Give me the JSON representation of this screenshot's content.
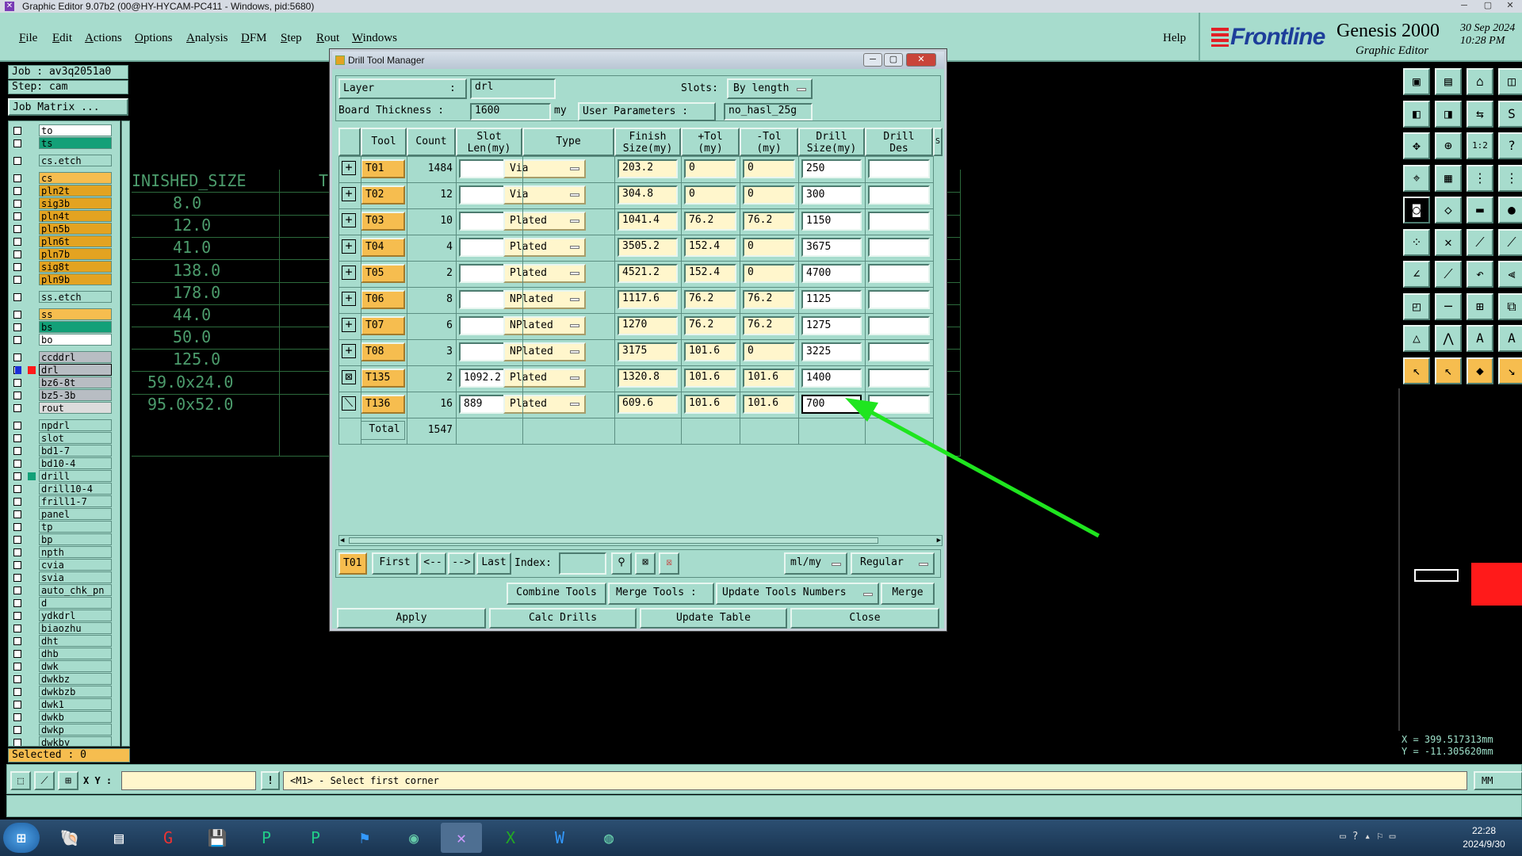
{
  "window": {
    "title": "Graphic Editor 9.07b2 (00@HY-HYCAM-PC411 - Windows, pid:5680)"
  },
  "menu": {
    "items": [
      "File",
      "Edit",
      "Actions",
      "Options",
      "Analysis",
      "DFM",
      "Step",
      "Rout",
      "Windows"
    ],
    "help": "Help"
  },
  "brand": {
    "logo": "Frontline",
    "product": "Genesis 2000",
    "subtitle": "Graphic Editor",
    "date": "30 Sep 2024",
    "time": "10:28 PM"
  },
  "job": {
    "job_label": "Job  : av3q2051a0",
    "step_label": "Step: cam",
    "matrix_button": "Job Matrix ..."
  },
  "layers": [
    {
      "name": "to",
      "color": "#ffffff"
    },
    {
      "name": "ts",
      "color": "#13a078"
    },
    {
      "name": "cs.etch",
      "color": "#a7dccd"
    },
    {
      "name": "cs",
      "color": "#f6bd4f"
    },
    {
      "name": "pln2t",
      "color": "#e3a321"
    },
    {
      "name": "sig3b",
      "color": "#e3a321"
    },
    {
      "name": "pln4t",
      "color": "#e3a321"
    },
    {
      "name": "pln5b",
      "color": "#e3a321"
    },
    {
      "name": "pln6t",
      "color": "#e3a321"
    },
    {
      "name": "pln7b",
      "color": "#e3a321"
    },
    {
      "name": "sig8t",
      "color": "#e3a321"
    },
    {
      "name": "pln9b",
      "color": "#e3a321"
    },
    {
      "name": "ss.etch",
      "color": "#a7dccd"
    },
    {
      "name": "ss",
      "color": "#f6bd4f"
    },
    {
      "name": "bs",
      "color": "#13a078"
    },
    {
      "name": "bo",
      "color": "#ffffff"
    },
    {
      "name": "ccddrl",
      "color": "#b8bdc3"
    },
    {
      "name": "drl",
      "color": "#b8bdc3"
    },
    {
      "name": "bz6-8t",
      "color": "#b8bdc3"
    },
    {
      "name": "bz5-3b",
      "color": "#b8bdc3"
    },
    {
      "name": "rout",
      "color": "#dcdcdc"
    },
    {
      "name": "npdrl",
      "color": "#a7dccd"
    },
    {
      "name": "slot",
      "color": "#a7dccd"
    },
    {
      "name": "bd1-7",
      "color": "#a7dccd"
    },
    {
      "name": "bd10-4",
      "color": "#a7dccd"
    },
    {
      "name": "drill",
      "color": "#a7dccd"
    },
    {
      "name": "drill10-4",
      "color": "#a7dccd"
    },
    {
      "name": "frill1-7",
      "color": "#a7dccd"
    },
    {
      "name": "panel",
      "color": "#a7dccd"
    },
    {
      "name": "tp",
      "color": "#a7dccd"
    },
    {
      "name": "bp",
      "color": "#a7dccd"
    },
    {
      "name": "npth",
      "color": "#a7dccd"
    },
    {
      "name": "cvia",
      "color": "#a7dccd"
    },
    {
      "name": "svia",
      "color": "#a7dccd"
    },
    {
      "name": "auto_chk_pn",
      "color": "#a7dccd"
    },
    {
      "name": "d",
      "color": "#a7dccd"
    },
    {
      "name": "ydkdrl",
      "color": "#a7dccd"
    },
    {
      "name": "biaozhu",
      "color": "#a7dccd"
    },
    {
      "name": "dht",
      "color": "#a7dccd"
    },
    {
      "name": "dhb",
      "color": "#a7dccd"
    },
    {
      "name": "dwk",
      "color": "#a7dccd"
    },
    {
      "name": "dwkbz",
      "color": "#a7dccd"
    },
    {
      "name": "dwkbzb",
      "color": "#a7dccd"
    },
    {
      "name": "dwk1",
      "color": "#a7dccd"
    },
    {
      "name": "dwkb",
      "color": "#a7dccd"
    },
    {
      "name": "dwkp",
      "color": "#a7dccd"
    },
    {
      "name": "dwkby",
      "color": "#a7dccd"
    }
  ],
  "selected_label": "Selected : 0",
  "canvas": {
    "header_partial": "INISHED_SIZE",
    "header_partial_2": "T",
    "values": [
      "8.0",
      "12.0",
      "41.0",
      "138.0",
      "178.0",
      "44.0",
      "50.0",
      "125.0",
      "59.0x24.0",
      "95.0x52.0"
    ]
  },
  "dialog": {
    "title": "Drill Tool Manager",
    "layer_label": "Layer",
    "layer_colon": ":",
    "layer_value": "drl",
    "slots_label": "Slots:",
    "slots_value": "By length",
    "thickness_label": "Board Thickness :",
    "thickness_value": "1600",
    "thickness_unit": "my",
    "user_params_label": "User Parameters :",
    "user_params_value": "no_hasl_25g",
    "columns": {
      "tool": "Tool",
      "count": "Count",
      "slot_len": "Slot\nLen(my)",
      "type": "Type",
      "finish": "Finish\nSize(my)",
      "ptol": "+Tol\n(my)",
      "ntol": "-Tol\n(my)",
      "drill": "Drill\nSize(my)",
      "drill_des": "Drill\nDes",
      "extra": "S"
    },
    "rows": [
      {
        "tool": "T01",
        "count": "1484",
        "slot": "",
        "type": "Via",
        "finish": "203.2",
        "ptol": "0",
        "ntol": "0",
        "drill": "250",
        "des": ""
      },
      {
        "tool": "T02",
        "count": "12",
        "slot": "",
        "type": "Via",
        "finish": "304.8",
        "ptol": "0",
        "ntol": "0",
        "drill": "300",
        "des": ""
      },
      {
        "tool": "T03",
        "count": "10",
        "slot": "",
        "type": "Plated",
        "finish": "1041.4",
        "ptol": "76.2",
        "ntol": "76.2",
        "drill": "1150",
        "des": ""
      },
      {
        "tool": "T04",
        "count": "4",
        "slot": "",
        "type": "Plated",
        "finish": "3505.2",
        "ptol": "152.4",
        "ntol": "0",
        "drill": "3675",
        "des": ""
      },
      {
        "tool": "T05",
        "count": "2",
        "slot": "",
        "type": "Plated",
        "finish": "4521.2",
        "ptol": "152.4",
        "ntol": "0",
        "drill": "4700",
        "des": ""
      },
      {
        "tool": "T06",
        "count": "8",
        "slot": "",
        "type": "NPlated",
        "finish": "1117.6",
        "ptol": "76.2",
        "ntol": "76.2",
        "drill": "1125",
        "des": ""
      },
      {
        "tool": "T07",
        "count": "6",
        "slot": "",
        "type": "NPlated",
        "finish": "1270",
        "ptol": "76.2",
        "ntol": "76.2",
        "drill": "1275",
        "des": ""
      },
      {
        "tool": "T08",
        "count": "3",
        "slot": "",
        "type": "NPlated",
        "finish": "3175",
        "ptol": "101.6",
        "ntol": "0",
        "drill": "3225",
        "des": ""
      },
      {
        "tool": "T135",
        "count": "2",
        "slot": "1092.2",
        "type": "Plated",
        "finish": "1320.8",
        "ptol": "101.6",
        "ntol": "101.6",
        "drill": "1400",
        "des": ""
      },
      {
        "tool": "T136",
        "count": "16",
        "slot": "889",
        "type": "Plated",
        "finish": "609.6",
        "ptol": "101.6",
        "ntol": "101.6",
        "drill": "700",
        "des": ""
      }
    ],
    "total_label": "Total",
    "total_count": "1547",
    "nav": {
      "current": "T01",
      "first": "First",
      "prev": "<--",
      "next": "-->",
      "last": "Last",
      "index_label": "Index:",
      "units": "ml/my",
      "mode": "Regular"
    },
    "actions": {
      "combine": "Combine Tools",
      "merge_tools": "Merge Tools  :",
      "update_numbers": "Update Tools Numbers",
      "merge": "Merge",
      "apply": "Apply",
      "calc": "Calc Drills",
      "update_table": "Update Table",
      "close": "Close"
    }
  },
  "status": {
    "xy_label": "X Y :",
    "prompt": "<M1> - Select first corner",
    "units": "MM"
  },
  "coords": {
    "x": "X = 399.517313mm",
    "y": "Y = -11.305620mm"
  },
  "clock": {
    "time": "22:28",
    "date": "2024/9/30"
  },
  "accent_colors": {
    "panel": "#a7dccd",
    "tool_highlight": "#f6bd4f",
    "annotation_arrow": "#1fe51f"
  }
}
